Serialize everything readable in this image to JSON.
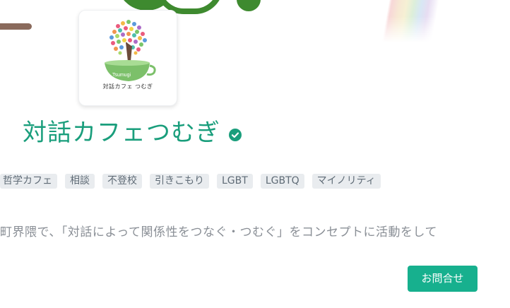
{
  "profile": {
    "name": "対話カフェつむぎ",
    "logo": {
      "brand_text": "Tsumugi",
      "caption": "対話カフェ つむぎ"
    },
    "verified_icon": "check-circle-icon"
  },
  "tags": [
    "哲学カフェ",
    "相談",
    "不登校",
    "引きこもり",
    "LGBT",
    "LGBTQ",
    "マイノリティ"
  ],
  "description": "町界隈で、「対話によって関係性をつなぐ・つむぐ」をコンセプトに活動をして",
  "actions": {
    "contact_label": "お問合せ"
  },
  "colors": {
    "accent": "#1a9e7c",
    "button": "#17b08e",
    "tag_bg": "#e9ecef"
  }
}
